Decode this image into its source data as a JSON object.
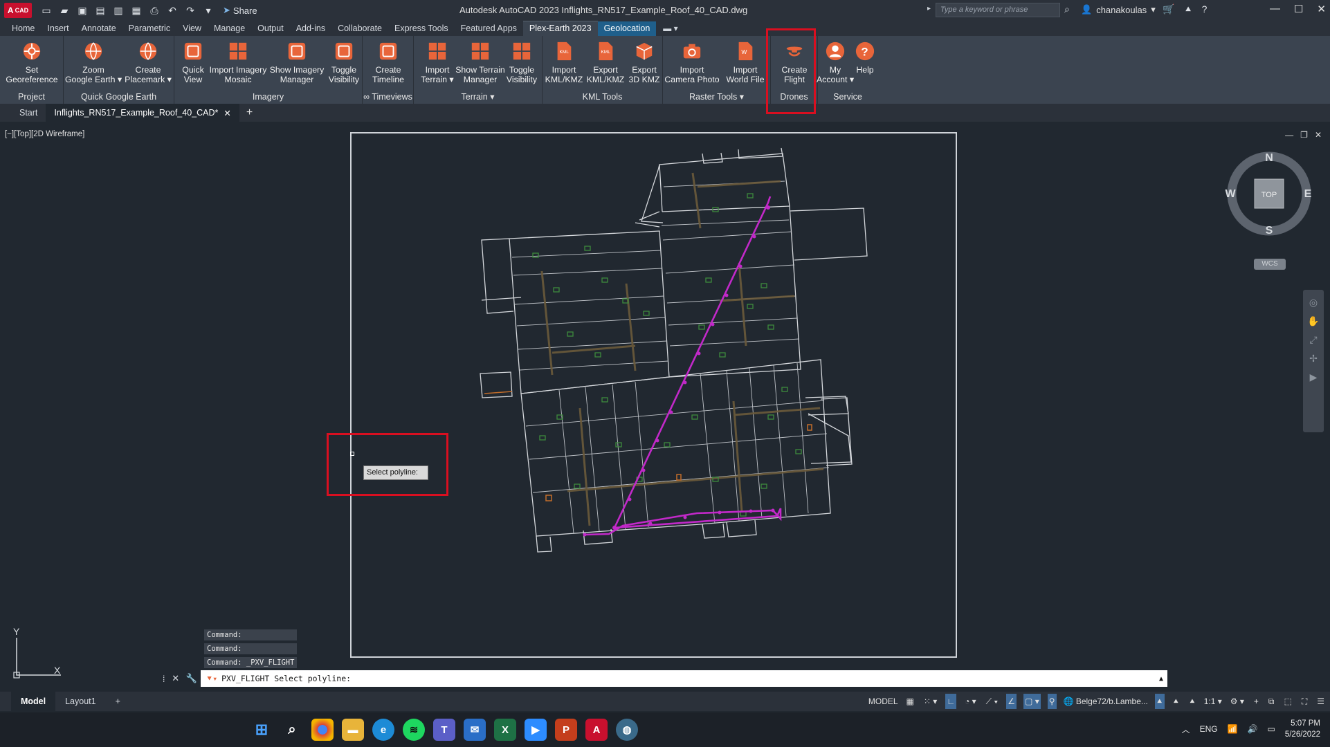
{
  "title_bar": {
    "app_badge": "CAD",
    "share_label": "Share",
    "window_title": "Autodesk AutoCAD 2023   Inflights_RN517_Example_Roof_40_CAD.dwg",
    "search_placeholder": "Type a keyword or phrase",
    "user_name": "chanakoulas"
  },
  "ribbon_tabs": [
    "Home",
    "Insert",
    "Annotate",
    "Parametric",
    "View",
    "Manage",
    "Output",
    "Add-ins",
    "Collaborate",
    "Express Tools",
    "Featured Apps",
    "Plex-Earth 2023",
    "Geolocation"
  ],
  "ribbon": {
    "panels": {
      "project": "Project",
      "quick_google_earth": "Quick Google Earth",
      "imagery": "Imagery",
      "timeviews": "∞ Timeviews",
      "terrain": "Terrain ▾",
      "kml_tools": "KML Tools",
      "raster_tools": "Raster Tools ▾",
      "drones": "Drones",
      "service": "Service"
    },
    "buttons": {
      "set_georeference": "Set\nGeoreference",
      "zoom_google_earth": "Zoom\nGoogle Earth ▾",
      "create_placemark": "Create\nPlacemark ▾",
      "quick_view": "Quick\nView",
      "import_imagery_mosaic": "Import Imagery\nMosaic",
      "show_imagery_manager": "Show Imagery\nManager",
      "toggle_visibility_imagery": "Toggle\nVisibility",
      "create_timeline": "Create\nTimeline",
      "import_terrain": "Import\nTerrain ▾",
      "show_terrain_manager": "Show Terrain\nManager",
      "toggle_visibility_terrain": "Toggle\nVisibility",
      "import_kml_kmz": "Import\nKML/KMZ",
      "export_kml_kmz": "Export\nKML/KMZ",
      "export_3d_kmz": "Export\n3D KMZ",
      "import_camera_photo": "Import\nCamera Photo",
      "import_world_file": "Import\nWorld File",
      "create_flight": "Create\nFlight",
      "my_account": "My\nAccount ▾",
      "help": "Help"
    }
  },
  "file_tabs": {
    "start": "Start",
    "current": "Inflights_RN517_Example_Roof_40_CAD*"
  },
  "viewport": {
    "label": "[−][Top][2D Wireframe]",
    "viewcube": {
      "n": "N",
      "s": "S",
      "e": "E",
      "w": "W",
      "face": "TOP"
    },
    "wcs": "WCS",
    "ucs_x": "X",
    "ucs_y": "Y",
    "tooltip": "Select polyline:"
  },
  "command_history": [
    "Command:",
    "Command:",
    "Command:  _PXV_FLIGHT"
  ],
  "command_line": "PXV_FLIGHT Select polyline:",
  "layout_tabs": [
    "Model",
    "Layout1"
  ],
  "status_bar": {
    "model": "MODEL",
    "coordinate_system": "Belge72/b.Lambe...",
    "scale": "1:1 ▾"
  },
  "taskbar": {
    "language": "ENG",
    "time": "5:07 PM",
    "date": "5/26/2022"
  },
  "colors": {
    "flight_path": "#c229c9",
    "highlight": "#d90f20",
    "plex_orange": "#e8653a",
    "geolocation_tab": "#1f5f8b"
  }
}
